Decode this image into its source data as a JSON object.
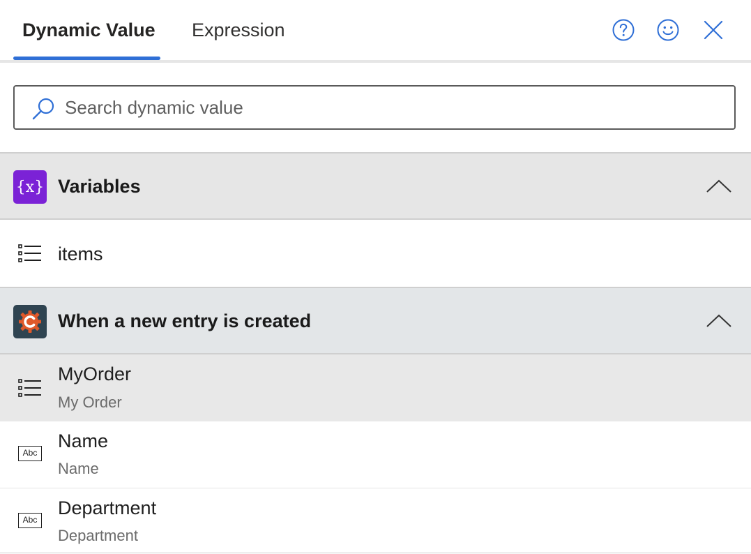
{
  "tabs": {
    "dynamic_value": "Dynamic Value",
    "expression": "Expression"
  },
  "header_icons": [
    "help-icon",
    "smiley-feedback-icon",
    "close-icon"
  ],
  "search": {
    "placeholder": "Search dynamic value",
    "value": ""
  },
  "sections": [
    {
      "title": "Variables",
      "icon": "{x}",
      "expanded": true,
      "items": [
        {
          "title": "items",
          "icon": "list-icon"
        }
      ]
    },
    {
      "title": "When a new entry is created",
      "icon": "connector-gear-icon",
      "expanded": true,
      "items": [
        {
          "title": "MyOrder",
          "subtitle": "My Order",
          "icon": "list-icon"
        },
        {
          "title": "Name",
          "subtitle": "Name",
          "icon": "text-abc-icon",
          "icon_text": "Abc"
        },
        {
          "title": "Department",
          "subtitle": "Department",
          "icon": "text-abc-icon",
          "icon_text": "Abc"
        }
      ]
    }
  ],
  "colors": {
    "accent": "#2f6fd6",
    "variables_icon_bg": "#7b22d6",
    "connector_icon_bg": "#2f4451",
    "connector_gear": "#e0592a",
    "section_bg": "#e6e6e6"
  }
}
